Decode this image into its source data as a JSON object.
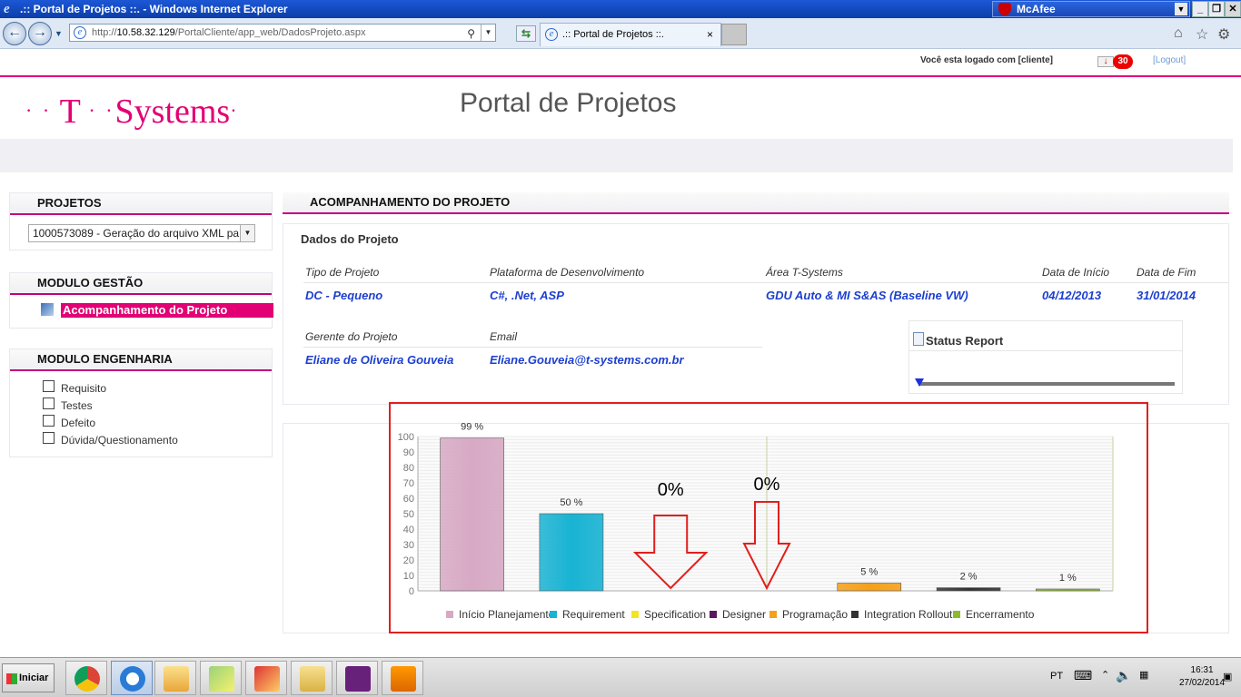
{
  "browser": {
    "window_title": ".:: Portal de Projetos ::. - Windows Internet Explorer",
    "mcafee_label": "McAfee",
    "address_prefix": "http://",
    "address_host": "10.58.32.129",
    "address_path": "/PortalCliente/app_web/DadosProjeto.aspx",
    "tab_title": ".:: Portal de Projetos ::.",
    "tab_close": "×"
  },
  "header": {
    "logged_text": "Você esta logado com [cliente]",
    "mail_count": "30",
    "logout_label": "[Logout]",
    "logo_text": "Systems",
    "logo_t": "T",
    "logo_dots_left": "· · ",
    "logo_dots_mid": " · ·",
    "logo_dot_end": "·",
    "portal_title": "Portal de Projetos"
  },
  "sidebar": {
    "projetos_title": "PROJETOS",
    "project_selected": "1000573089 - Geração do arquivo XML pa",
    "gestao_title": "MODULO GESTÃO",
    "gestao_item": "Acompanhamento do Projeto",
    "engenharia_title": "MODULO ENGENHARIA",
    "engenharia_items": [
      {
        "label": "Requisito",
        "icon_color": "#8a3aa8"
      },
      {
        "label": "Testes",
        "icon_color": "#2b2b2b"
      },
      {
        "label": "Defeito",
        "icon_color": "#d42020"
      },
      {
        "label": "Dúvida/Questionamento",
        "icon_color": "#c00000"
      }
    ]
  },
  "main": {
    "section_title": "ACOMPANHAMENTO DO PROJETO",
    "dados_title": "Dados do Projeto",
    "labels": {
      "tipo": "Tipo de Projeto",
      "plataforma": "Plataforma de Desenvolvimento",
      "area": "Área T-Systems",
      "inicio": "Data de Início",
      "fim": "Data de Fim",
      "gerente": "Gerente do Projeto",
      "email": "Email"
    },
    "values": {
      "tipo": "DC - Pequeno",
      "plataforma": "C#, .Net, ASP",
      "area": "GDU Auto & MI S&AS (Baseline VW)",
      "inicio": "04/12/2013",
      "fim": "31/01/2014",
      "gerente": "Eliane de Oliveira Gouveia",
      "email": "Eliane.Gouveia@t-systems.com.br"
    },
    "status_report_title": "Status Report",
    "status_progress": 0
  },
  "chart_data": {
    "type": "bar",
    "categories": [
      "Início Planejamento",
      "Requirement",
      "Specification",
      "Designer",
      "Programação",
      "Integration Rollout",
      "Encerramento"
    ],
    "values": [
      99,
      50,
      0,
      0,
      5,
      2,
      1
    ],
    "value_labels": [
      "99 %",
      "50 %",
      "",
      "",
      "5 %",
      "2 %",
      "1 %"
    ],
    "colors": [
      "#d7a9c4",
      "#19b3d3",
      "#f2e51f",
      "#5a1760",
      "#f5a01a",
      "#333333",
      "#8dbb2a"
    ],
    "ylim": [
      0,
      100
    ],
    "yticks": [
      0,
      10,
      20,
      30,
      40,
      50,
      60,
      70,
      80,
      90,
      100
    ],
    "grid": true,
    "legend": "bottom",
    "annotations": [
      "0%",
      "0%"
    ]
  },
  "taskbar": {
    "start_label": "Iniciar",
    "lang": "PT",
    "time": "16:31",
    "date": "27/02/2014"
  }
}
